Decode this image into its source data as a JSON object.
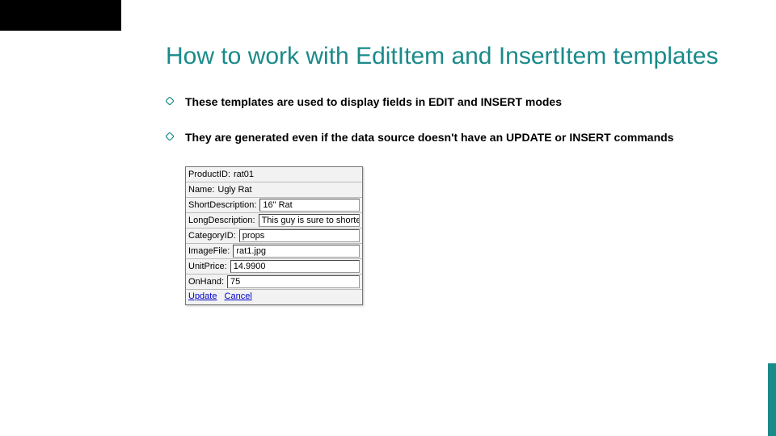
{
  "colors": {
    "accent": "#1a8a8a"
  },
  "decor": {
    "topbar": true,
    "rightbar": true
  },
  "title": "How to work with EditItem and InsertItem templates",
  "bullets": [
    "These templates are used to display fields in EDIT and INSERT modes",
    "They are generated even if the data source doesn't have an UPDATE or INSERT commands"
  ],
  "form": {
    "rows": [
      {
        "label": "ProductID:",
        "value": "rat01",
        "readonly": true
      },
      {
        "label": "Name:",
        "value": "Ugly Rat",
        "readonly": true
      },
      {
        "label": "ShortDescription:",
        "value": "16\" Rat"
      },
      {
        "label": "LongDescription:",
        "value": "This guy is sure to shorte"
      },
      {
        "label": "CategoryID:",
        "value": "props"
      },
      {
        "label": "ImageFile:",
        "value": "rat1.jpg"
      },
      {
        "label": "UnitPrice:",
        "value": "14.9900"
      },
      {
        "label": "OnHand:",
        "value": "75"
      }
    ],
    "links": {
      "update": "Update",
      "cancel": "Cancel"
    }
  }
}
